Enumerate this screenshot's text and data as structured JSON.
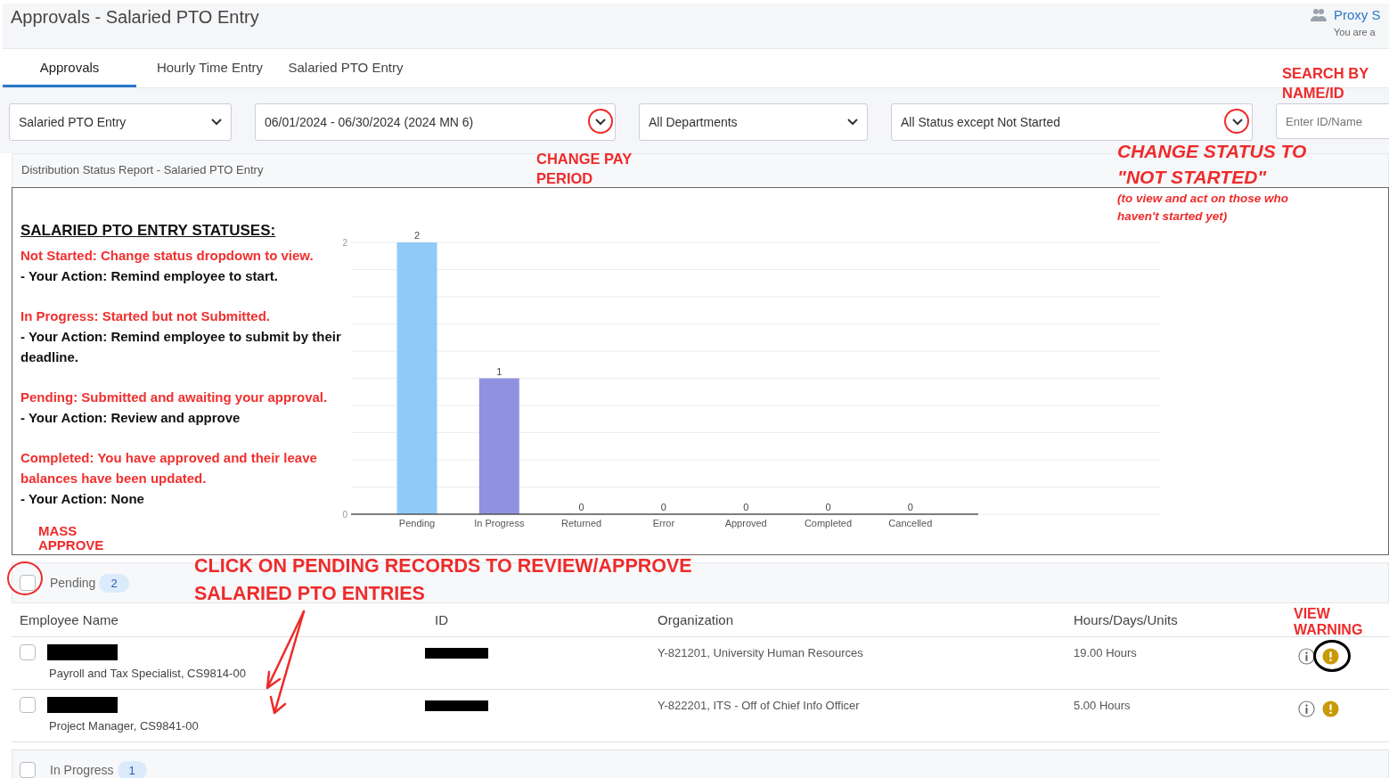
{
  "header": {
    "title": "Approvals - Salaried PTO Entry",
    "proxy_label": "Proxy S",
    "proxy_note": "You are a"
  },
  "tabs": [
    {
      "label": "Approvals",
      "selected": true
    },
    {
      "label": "Hourly Time Entry",
      "selected": false
    },
    {
      "label": "Salaried PTO Entry",
      "selected": false
    }
  ],
  "filters": [
    {
      "kind": "select",
      "value": "Salaried PTO Entry"
    },
    {
      "kind": "select",
      "value": "06/01/2024 - 06/30/2024 (2024 MN 6)"
    },
    {
      "kind": "select",
      "value": "All Departments"
    },
    {
      "kind": "select",
      "value": "All Status except Not Started"
    },
    {
      "kind": "search",
      "placeholder": "Enter ID/Name"
    }
  ],
  "report": {
    "title": "Distribution Status Report - Salaried PTO Entry",
    "legend_heading": "SALARIED PTO ENTRY STATUSES:",
    "legend": [
      {
        "status": "Not Started: Change status dropdown to view.",
        "action": "- Your Action: Remind employee to start."
      },
      {
        "status": "In Progress: Started but not Submitted.",
        "action": "- Your Action: Remind employee to submit by their deadline."
      },
      {
        "status": "Pending: Submitted and awaiting your approval.",
        "action": "- Your Action: Review and approve"
      },
      {
        "status": "Completed: You have approved and their leave balances have been updated.",
        "action": "- Your Action: None"
      }
    ],
    "chart_data": {
      "type": "bar",
      "categories": [
        "Pending",
        "In Progress",
        "Returned",
        "Error",
        "Approved",
        "Completed",
        "Cancelled"
      ],
      "series": [
        {
          "color": "#90caf9",
          "values": [
            2,
            null,
            0,
            0,
            0,
            0,
            0
          ]
        },
        {
          "color": "#9191e1",
          "values": [
            null,
            1,
            null,
            null,
            null,
            null,
            null
          ]
        }
      ],
      "ylim": [
        0,
        2
      ],
      "yticks": [
        0,
        2
      ],
      "data_labels": true
    }
  },
  "table": {
    "columns": [
      "Employee Name",
      "ID",
      "Organization",
      "Hours/Days/Units"
    ]
  },
  "groups": [
    {
      "label": "Pending",
      "count": "2",
      "checked": false,
      "rows": [
        {
          "title": "Payroll and Tax Specialist, CS9814-00",
          "organization": "Y-821201, University Human Resources",
          "amount": "19.00 Hours",
          "checked": false
        },
        {
          "title": "Project Manager, CS9841-00",
          "organization": "Y-822201, ITS - Off of Chief Info Officer",
          "amount": "5.00 Hours",
          "checked": false
        }
      ]
    },
    {
      "label": "In Progress",
      "count": "1",
      "checked": false
    }
  ],
  "annotations": [
    {
      "kind": "label",
      "text": "CHANGE PAY PERIOD"
    },
    {
      "kind": "label",
      "text": "SEARCH BY NAME/ID"
    },
    {
      "kind": "callout",
      "text": "CHANGE STATUS TO \"NOT STARTED\""
    },
    {
      "kind": "note",
      "text": "(to view and act on those who haven't started yet)"
    },
    {
      "kind": "label",
      "text": "MASS APPROVE"
    },
    {
      "kind": "banner",
      "text": "CLICK ON PENDING RECORDS TO REVIEW/APPROVE SALARIED PTO ENTRIES"
    },
    {
      "kind": "label",
      "text": "VIEW WARNING"
    }
  ]
}
